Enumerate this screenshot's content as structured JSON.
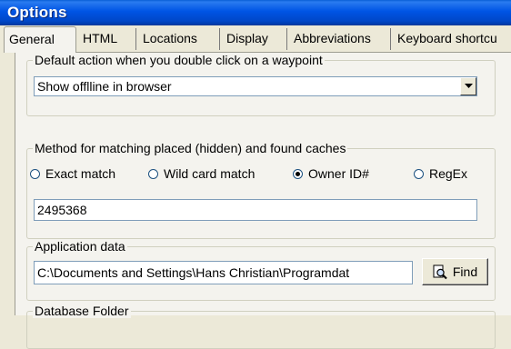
{
  "window": {
    "title": "Options"
  },
  "tabs": [
    {
      "label": "General"
    },
    {
      "label": "HTML"
    },
    {
      "label": "Locations"
    },
    {
      "label": "Display"
    },
    {
      "label": "Abbreviations"
    },
    {
      "label": "Keyboard shortcu"
    }
  ],
  "double_click": {
    "legend": "Default action when you double click on a waypoint",
    "selected": "Show offlline in browser"
  },
  "matching": {
    "legend": "Method for matching placed (hidden) and found caches",
    "options": [
      {
        "label": "Exact match",
        "checked": false
      },
      {
        "label": "Wild card match",
        "checked": false
      },
      {
        "label": "Owner ID#",
        "checked": true
      },
      {
        "label": "RegEx",
        "checked": false
      }
    ],
    "value": "2495368"
  },
  "app_data": {
    "legend": "Application data",
    "path": "C:\\Documents and Settings\\Hans Christian\\Programdat",
    "find_label": "Find"
  },
  "next_group": {
    "legend": "Database Folder"
  }
}
